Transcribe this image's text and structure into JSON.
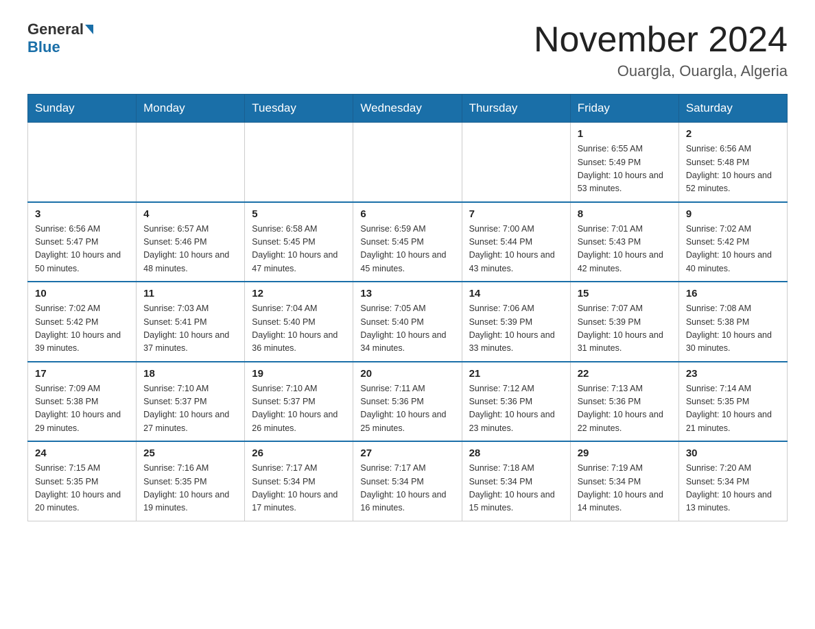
{
  "header": {
    "logo_general": "General",
    "logo_blue": "Blue",
    "month_title": "November 2024",
    "location": "Ouargla, Ouargla, Algeria"
  },
  "weekdays": [
    "Sunday",
    "Monday",
    "Tuesday",
    "Wednesday",
    "Thursday",
    "Friday",
    "Saturday"
  ],
  "weeks": [
    [
      {
        "day": "",
        "info": ""
      },
      {
        "day": "",
        "info": ""
      },
      {
        "day": "",
        "info": ""
      },
      {
        "day": "",
        "info": ""
      },
      {
        "day": "",
        "info": ""
      },
      {
        "day": "1",
        "info": "Sunrise: 6:55 AM\nSunset: 5:49 PM\nDaylight: 10 hours and 53 minutes."
      },
      {
        "day": "2",
        "info": "Sunrise: 6:56 AM\nSunset: 5:48 PM\nDaylight: 10 hours and 52 minutes."
      }
    ],
    [
      {
        "day": "3",
        "info": "Sunrise: 6:56 AM\nSunset: 5:47 PM\nDaylight: 10 hours and 50 minutes."
      },
      {
        "day": "4",
        "info": "Sunrise: 6:57 AM\nSunset: 5:46 PM\nDaylight: 10 hours and 48 minutes."
      },
      {
        "day": "5",
        "info": "Sunrise: 6:58 AM\nSunset: 5:45 PM\nDaylight: 10 hours and 47 minutes."
      },
      {
        "day": "6",
        "info": "Sunrise: 6:59 AM\nSunset: 5:45 PM\nDaylight: 10 hours and 45 minutes."
      },
      {
        "day": "7",
        "info": "Sunrise: 7:00 AM\nSunset: 5:44 PM\nDaylight: 10 hours and 43 minutes."
      },
      {
        "day": "8",
        "info": "Sunrise: 7:01 AM\nSunset: 5:43 PM\nDaylight: 10 hours and 42 minutes."
      },
      {
        "day": "9",
        "info": "Sunrise: 7:02 AM\nSunset: 5:42 PM\nDaylight: 10 hours and 40 minutes."
      }
    ],
    [
      {
        "day": "10",
        "info": "Sunrise: 7:02 AM\nSunset: 5:42 PM\nDaylight: 10 hours and 39 minutes."
      },
      {
        "day": "11",
        "info": "Sunrise: 7:03 AM\nSunset: 5:41 PM\nDaylight: 10 hours and 37 minutes."
      },
      {
        "day": "12",
        "info": "Sunrise: 7:04 AM\nSunset: 5:40 PM\nDaylight: 10 hours and 36 minutes."
      },
      {
        "day": "13",
        "info": "Sunrise: 7:05 AM\nSunset: 5:40 PM\nDaylight: 10 hours and 34 minutes."
      },
      {
        "day": "14",
        "info": "Sunrise: 7:06 AM\nSunset: 5:39 PM\nDaylight: 10 hours and 33 minutes."
      },
      {
        "day": "15",
        "info": "Sunrise: 7:07 AM\nSunset: 5:39 PM\nDaylight: 10 hours and 31 minutes."
      },
      {
        "day": "16",
        "info": "Sunrise: 7:08 AM\nSunset: 5:38 PM\nDaylight: 10 hours and 30 minutes."
      }
    ],
    [
      {
        "day": "17",
        "info": "Sunrise: 7:09 AM\nSunset: 5:38 PM\nDaylight: 10 hours and 29 minutes."
      },
      {
        "day": "18",
        "info": "Sunrise: 7:10 AM\nSunset: 5:37 PM\nDaylight: 10 hours and 27 minutes."
      },
      {
        "day": "19",
        "info": "Sunrise: 7:10 AM\nSunset: 5:37 PM\nDaylight: 10 hours and 26 minutes."
      },
      {
        "day": "20",
        "info": "Sunrise: 7:11 AM\nSunset: 5:36 PM\nDaylight: 10 hours and 25 minutes."
      },
      {
        "day": "21",
        "info": "Sunrise: 7:12 AM\nSunset: 5:36 PM\nDaylight: 10 hours and 23 minutes."
      },
      {
        "day": "22",
        "info": "Sunrise: 7:13 AM\nSunset: 5:36 PM\nDaylight: 10 hours and 22 minutes."
      },
      {
        "day": "23",
        "info": "Sunrise: 7:14 AM\nSunset: 5:35 PM\nDaylight: 10 hours and 21 minutes."
      }
    ],
    [
      {
        "day": "24",
        "info": "Sunrise: 7:15 AM\nSunset: 5:35 PM\nDaylight: 10 hours and 20 minutes."
      },
      {
        "day": "25",
        "info": "Sunrise: 7:16 AM\nSunset: 5:35 PM\nDaylight: 10 hours and 19 minutes."
      },
      {
        "day": "26",
        "info": "Sunrise: 7:17 AM\nSunset: 5:34 PM\nDaylight: 10 hours and 17 minutes."
      },
      {
        "day": "27",
        "info": "Sunrise: 7:17 AM\nSunset: 5:34 PM\nDaylight: 10 hours and 16 minutes."
      },
      {
        "day": "28",
        "info": "Sunrise: 7:18 AM\nSunset: 5:34 PM\nDaylight: 10 hours and 15 minutes."
      },
      {
        "day": "29",
        "info": "Sunrise: 7:19 AM\nSunset: 5:34 PM\nDaylight: 10 hours and 14 minutes."
      },
      {
        "day": "30",
        "info": "Sunrise: 7:20 AM\nSunset: 5:34 PM\nDaylight: 10 hours and 13 minutes."
      }
    ]
  ]
}
